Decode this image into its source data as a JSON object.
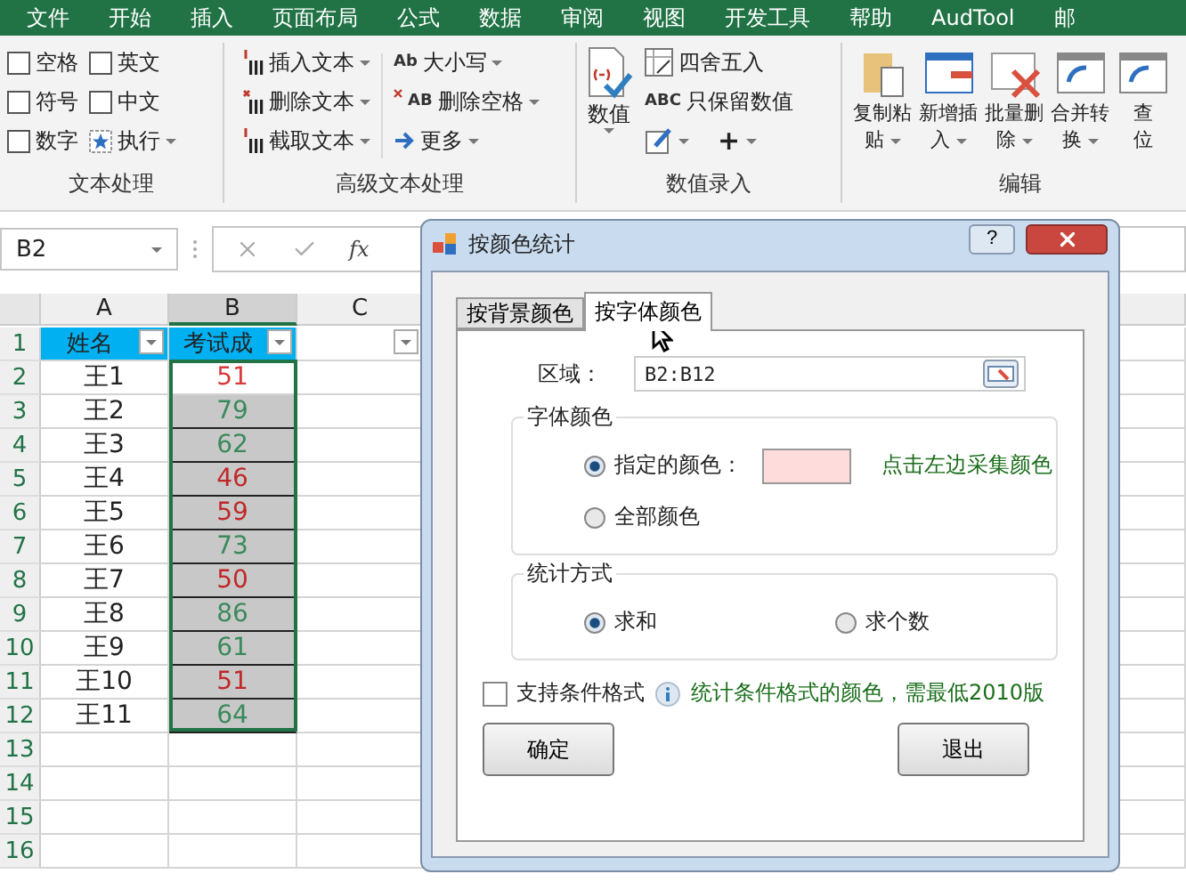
{
  "menu_tabs": [
    "文件",
    "开始",
    "插入",
    "页面布局",
    "公式",
    "数据",
    "审阅",
    "视图",
    "开发工具",
    "帮助",
    "AudTool",
    "邮"
  ],
  "ribbon": {
    "text_group": {
      "label": "文本处理",
      "checks": [
        {
          "label": "空格",
          "checked": false
        },
        {
          "label": "英文",
          "checked": false
        },
        {
          "label": "符号",
          "checked": false
        },
        {
          "label": "中文",
          "checked": false
        },
        {
          "label": "数字",
          "checked": false
        }
      ],
      "run": "执行"
    },
    "advanced_group": {
      "label": "高级文本处理",
      "left": [
        "插入文本",
        "删除文本",
        "截取文本"
      ],
      "right": [
        "大小写",
        "删除空格",
        "更多"
      ],
      "right_icons": [
        "Ab",
        "AB"
      ]
    },
    "number_group": {
      "label": "数值录入",
      "big": "数值",
      "items": [
        "四舍五入",
        "只保留数值"
      ],
      "abc": "ABC",
      "plus": "+"
    },
    "edit_group": {
      "label": "编辑",
      "buttons": [
        {
          "line1": "复制粘",
          "line2": "贴"
        },
        {
          "line1": "新增插",
          "line2": "入"
        },
        {
          "line1": "批量删",
          "line2": "除"
        },
        {
          "line1": "合并转",
          "line2": "换"
        },
        {
          "line1": "查",
          "line2": "位"
        }
      ]
    }
  },
  "formula_bar": {
    "name_box": "B2",
    "fx": "fx"
  },
  "sheet": {
    "columns": [
      "A",
      "B",
      "C"
    ],
    "header_row": {
      "number": "1",
      "cells": [
        "姓名",
        "考试成"
      ]
    },
    "rows": [
      {
        "number": "2",
        "name": "王1",
        "score": "51",
        "color": "#d63a3a",
        "active": true
      },
      {
        "number": "3",
        "name": "王2",
        "score": "79",
        "color": "#3a8a5a",
        "active": false
      },
      {
        "number": "4",
        "name": "王3",
        "score": "62",
        "color": "#3a8a5a",
        "active": false
      },
      {
        "number": "5",
        "name": "王4",
        "score": "46",
        "color": "#c02828",
        "active": false
      },
      {
        "number": "6",
        "name": "王5",
        "score": "59",
        "color": "#c02828",
        "active": false
      },
      {
        "number": "7",
        "name": "王6",
        "score": "73",
        "color": "#3a8a5a",
        "active": false
      },
      {
        "number": "8",
        "name": "王7",
        "score": "50",
        "color": "#c02828",
        "active": false
      },
      {
        "number": "9",
        "name": "王8",
        "score": "86",
        "color": "#3a8a5a",
        "active": false
      },
      {
        "number": "10",
        "name": "王9",
        "score": "61",
        "color": "#3a8a5a",
        "active": false
      },
      {
        "number": "11",
        "name": "王10",
        "score": "51",
        "color": "#c02828",
        "active": false
      },
      {
        "number": "12",
        "name": "王11",
        "score": "64",
        "color": "#3a8a5a",
        "active": false
      }
    ],
    "empty_rows": [
      "13",
      "14",
      "15",
      "16"
    ]
  },
  "dialog": {
    "title": "按颜色统计",
    "help": "?",
    "tabs": [
      {
        "label": "按背景颜色",
        "selected": false
      },
      {
        "label": "按字体颜色",
        "selected": true
      }
    ],
    "range_label": "区域：",
    "range_value": "B2:B12",
    "font_group": {
      "title": "字体颜色",
      "options": [
        {
          "label": "指定的颜色：",
          "selected": true
        },
        {
          "label": "全部颜色",
          "selected": false
        }
      ],
      "swatch": {
        "color": "#ffdcdc"
      },
      "hint": "点击左边采集颜色"
    },
    "method_group": {
      "title": "统计方式",
      "options": [
        {
          "label": "求和",
          "selected": true
        },
        {
          "label": "求个数",
          "selected": false
        }
      ]
    },
    "conditional": {
      "label": "支持条件格式",
      "checked": false
    },
    "note": "统计条件格式的颜色，需最低2010版",
    "buttons": [
      "确定",
      "退出"
    ]
  }
}
